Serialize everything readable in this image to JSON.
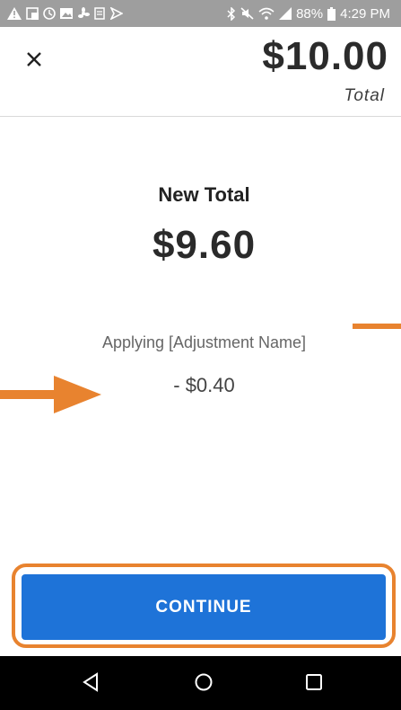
{
  "status_bar": {
    "battery": "88%",
    "time": "4:29 PM"
  },
  "header": {
    "amount": "$10.00",
    "label": "Total"
  },
  "main": {
    "new_total_label": "New Total",
    "new_total_amount": "$9.60",
    "adjustment_label": "Applying [Adjustment Name]",
    "adjustment_amount": "- $0.40"
  },
  "continue_button": {
    "label": "CONTINUE"
  },
  "colors": {
    "accent": "#1e73d8",
    "highlight": "#e8832f"
  },
  "icons": [
    "close-icon",
    "back-icon",
    "home-icon",
    "recents-icon"
  ]
}
